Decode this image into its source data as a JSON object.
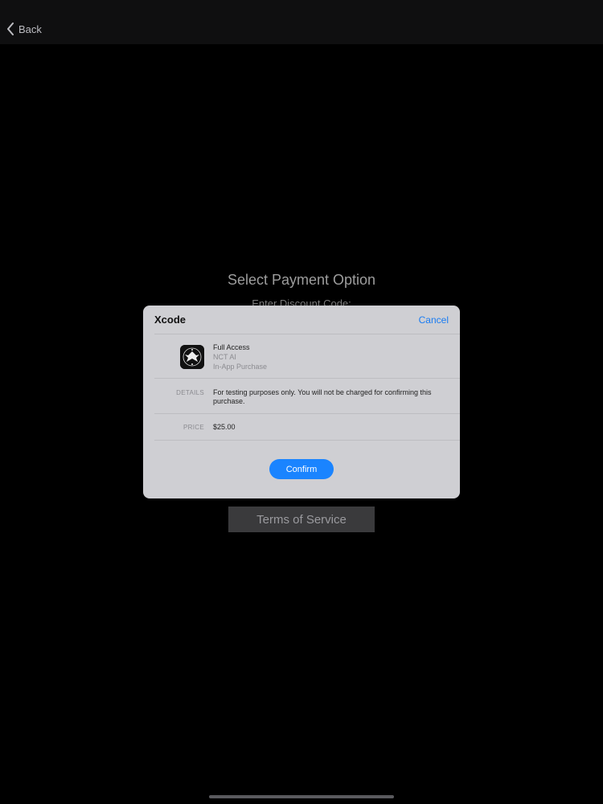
{
  "nav": {
    "back_label": "Back",
    "back_icon": "chevron-left-icon"
  },
  "page": {
    "title": "Select Payment Option",
    "discount_label": "Enter Discount Code:",
    "terms_label": "Terms of Service"
  },
  "sheet": {
    "app_name": "Xcode",
    "cancel_label": "Cancel",
    "product": {
      "icon": "app-icon",
      "name": "Full Access",
      "developer": "NCT AI",
      "type": "In-App Purchase"
    },
    "details_label": "DETAILS",
    "details_text": "For testing purposes only. You will not be charged for confirming this purchase.",
    "price_label": "PRICE",
    "price_value": "$25.00",
    "confirm_label": "Confirm"
  },
  "colors": {
    "accent": "#1a84ff",
    "link": "#1a7cf2",
    "sheet_bg": "#cfcfd3"
  }
}
